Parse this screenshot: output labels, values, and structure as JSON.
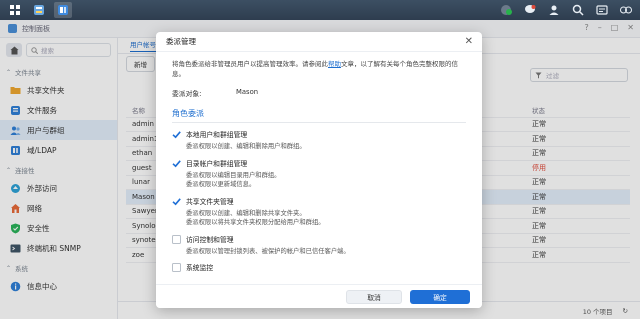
{
  "colors": {
    "accent": "#1f6fd6",
    "link": "#1f6fcf",
    "disabled_status": "#e04a3a",
    "check_blue": "#1f6fd6"
  },
  "window": {
    "title": "控制面板",
    "search_placeholder": "搜索"
  },
  "sidebar": {
    "sections": [
      {
        "label": "文件共享",
        "items": [
          {
            "label": "共享文件夹",
            "icon": "shared-folder-icon"
          },
          {
            "label": "文件服务",
            "icon": "file-services-icon"
          },
          {
            "label": "用户与群组",
            "icon": "user-group-icon",
            "selected": true
          },
          {
            "label": "域/LDAP",
            "icon": "domain-ldap-icon"
          }
        ]
      },
      {
        "label": "连接性",
        "items": [
          {
            "label": "外部访问",
            "icon": "external-access-icon"
          },
          {
            "label": "网络",
            "icon": "network-icon"
          },
          {
            "label": "安全性",
            "icon": "security-icon"
          },
          {
            "label": "终端机和 SNMP",
            "icon": "terminal-snmp-icon"
          }
        ]
      },
      {
        "label": "系统",
        "items": [
          {
            "label": "信息中心",
            "icon": "info-center-icon"
          }
        ]
      }
    ]
  },
  "main": {
    "tab": "用户帐号",
    "new_button": "新增",
    "filter_placeholder": "过滤",
    "columns": {
      "name": "名称",
      "status": "状态"
    },
    "rows": [
      {
        "name": "admin",
        "status": "正常"
      },
      {
        "name": "admin1",
        "status": "正常"
      },
      {
        "name": "ethan",
        "status": "正常"
      },
      {
        "name": "guest",
        "status": "停用"
      },
      {
        "name": "lunar",
        "status": "正常"
      },
      {
        "name": "Mason",
        "status": "正常"
      },
      {
        "name": "Sawyer",
        "status": "正常"
      },
      {
        "name": "Synology",
        "status": "正常"
      },
      {
        "name": "synotes",
        "status": "正常"
      },
      {
        "name": "zoe",
        "status": "正常"
      }
    ],
    "item_count": "10 个项目"
  },
  "dialog": {
    "title": "委派管理",
    "description_before": "将角色委派给非管理员用户以提高管理效率。请参阅此",
    "description_link": "帮助",
    "description_after": "文章，以了解有关每个角色完整权限的信息。",
    "target_label": "委派对象:",
    "target_value": "Mason",
    "section_title": "角色委派",
    "permissions": [
      {
        "title": "本地用户和群组管理",
        "desc": "委派权限以创建、编辑和删除用户和群组。",
        "checked": true
      },
      {
        "title": "目录帐户和群组管理",
        "desc": "委派权限以编辑目录用户和群组。\n委派权限以更新域信息。",
        "checked": true
      },
      {
        "title": "共享文件夹管理",
        "desc": "委派权限以创建、编辑和删除共享文件夹。\n委派权限以将共享文件夹权限分配给用户和群组。",
        "checked": true
      },
      {
        "title": "访问控制和管理",
        "desc": "委派权限以管理封锁列表、被保护的帐户和已信任客户端。",
        "checked": false
      },
      {
        "title": "系统监控",
        "desc": "",
        "checked": false
      }
    ],
    "cancel_label": "取消",
    "ok_label": "确定"
  }
}
